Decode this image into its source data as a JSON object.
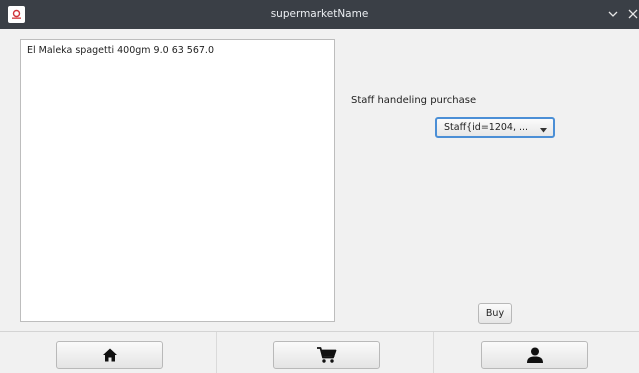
{
  "window": {
    "title": "supermarketName",
    "app_icon": "app-logo-icon",
    "controls": [
      "minimize-icon",
      "close-icon"
    ]
  },
  "cart": {
    "items": [
      {
        "text": "El Maleka spagetti 400gm 9.0 63 567.0"
      }
    ]
  },
  "purchase": {
    "staff_label": "Staff handeling purchase",
    "staff_selected": "Staff{id=1204, ...",
    "buy_label": "Buy"
  },
  "nav": {
    "buttons": [
      {
        "icon": "home-icon"
      },
      {
        "icon": "cart-icon"
      },
      {
        "icon": "user-icon"
      }
    ]
  },
  "colors": {
    "titlebar": "#3a3f46",
    "focus_border": "#4b8fd6",
    "background": "#f1f1f1"
  }
}
